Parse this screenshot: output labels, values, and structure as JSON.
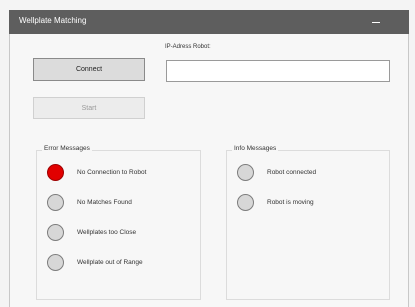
{
  "window": {
    "title": "Wellplate Matching"
  },
  "controls": {
    "connect_label": "Connect",
    "start_label": "Start",
    "ip_label": "IP-Adress Robot:",
    "ip_value": ""
  },
  "error_group": {
    "title": "Error Messages",
    "items": [
      {
        "label": "No Connection to Robot",
        "active": true
      },
      {
        "label": "No Matches Found",
        "active": false
      },
      {
        "label": "Wellplates too Close",
        "active": false
      },
      {
        "label": "Wellplate out of Range",
        "active": false
      }
    ]
  },
  "info_group": {
    "title": "Info Messages",
    "items": [
      {
        "label": "Robot connected",
        "active": false
      },
      {
        "label": "Robot is moving",
        "active": false
      }
    ]
  },
  "colors": {
    "led_active": "#e10000",
    "led_inactive": "#d7d7d7",
    "titlebar": "#5e5e5e"
  }
}
